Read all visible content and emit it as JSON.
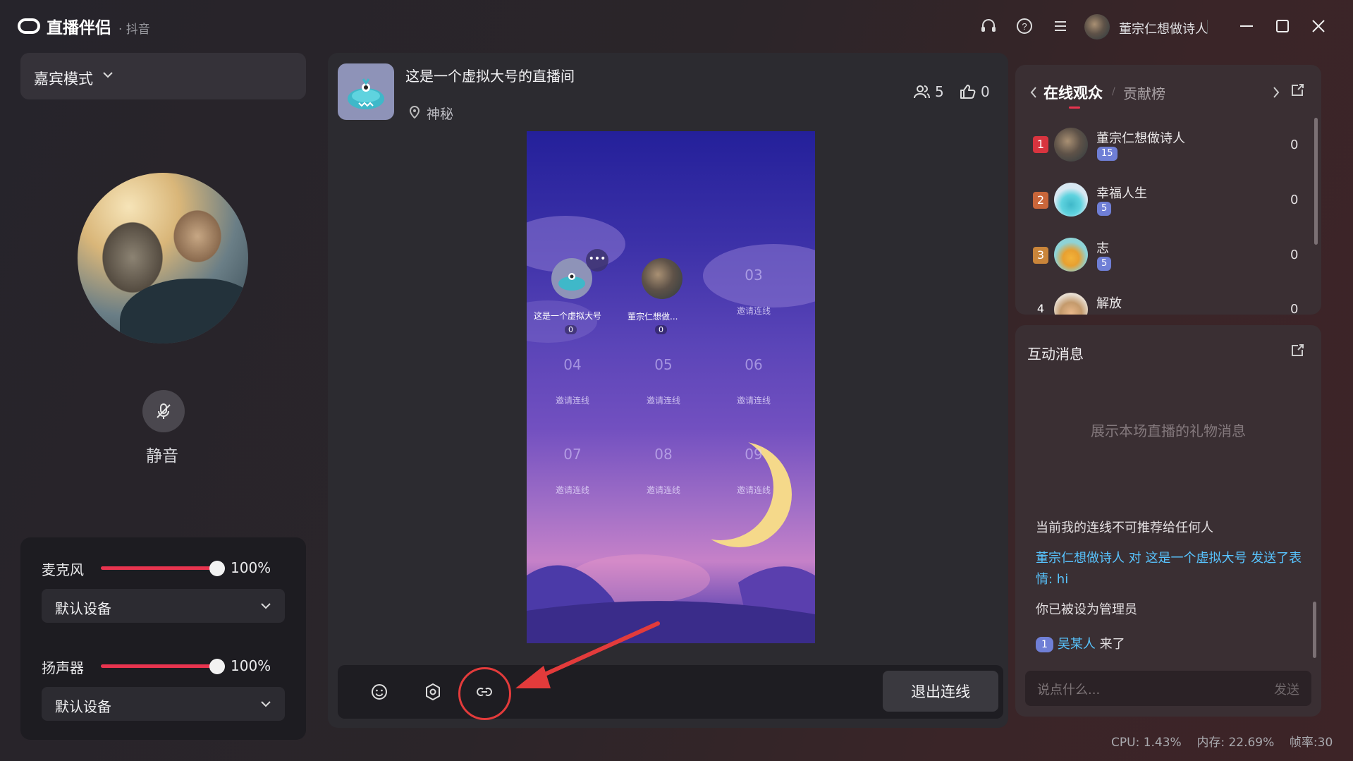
{
  "app": {
    "name": "直播伴侣",
    "sub": "· 抖音"
  },
  "titlebar": {
    "icons": [
      "headset-icon",
      "help-icon",
      "menu-icon"
    ],
    "user_name": "董宗仁想做诗人",
    "window_controls": [
      "minimize-icon",
      "maximize-icon",
      "close-icon"
    ]
  },
  "left": {
    "mode_label": "嘉宾模式",
    "mute_label": "静音",
    "mic": {
      "label": "麦克风",
      "volume_pct": 100,
      "volume_text": "100%",
      "device": "默认设备"
    },
    "speaker": {
      "label": "扬声器",
      "volume_pct": 100,
      "volume_text": "100%",
      "device": "默认设备"
    }
  },
  "room": {
    "title": "这是一个虚拟大号的直播间",
    "location": "神秘",
    "viewers": "5",
    "likes": "0"
  },
  "stage": {
    "seat1": {
      "name": "这是一个虚拟大号",
      "count": "0"
    },
    "seat2": {
      "name": "董宗仁想做...",
      "count": "0"
    },
    "slots": [
      "03",
      "04",
      "05",
      "06",
      "07",
      "08",
      "09"
    ],
    "invite_label": "邀请连线"
  },
  "bottombar": {
    "icons": [
      "emoji-icon",
      "settings-icon",
      "link-icon"
    ],
    "exit_label": "退出连线"
  },
  "audience": {
    "tab_online": "在线观众",
    "tab_contrib": "贡献榜",
    "rows": [
      {
        "rank": "1",
        "name": "董宗仁想做诗人",
        "level": "15",
        "score": "0"
      },
      {
        "rank": "2",
        "name": "幸福人生",
        "level": "5",
        "score": "0"
      },
      {
        "rank": "3",
        "name": "志",
        "level": "5",
        "score": "0"
      },
      {
        "rank": "4",
        "name": "解放",
        "score": "0"
      }
    ]
  },
  "interact": {
    "title": "互动消息",
    "placeholder": "展示本场直播的礼物消息",
    "msg1": "当前我的连线不可推荐给任何人",
    "msg2": "董宗仁想做诗人 对 这是一个虚拟大号 发送了表情: hi",
    "msg3": "你已被设为管理员",
    "msg4_level": "1",
    "msg4_user": "吴某人",
    "msg4_text": " 来了",
    "input_placeholder": "说点什么...",
    "send_label": "发送"
  },
  "status": {
    "cpu": "CPU: 1.43%",
    "mem": "内存: 22.69%",
    "fps": "帧率:30"
  },
  "colors": {
    "accent": "#e8344f",
    "link": "#58c4ff",
    "badge": "#6f7fd6"
  }
}
